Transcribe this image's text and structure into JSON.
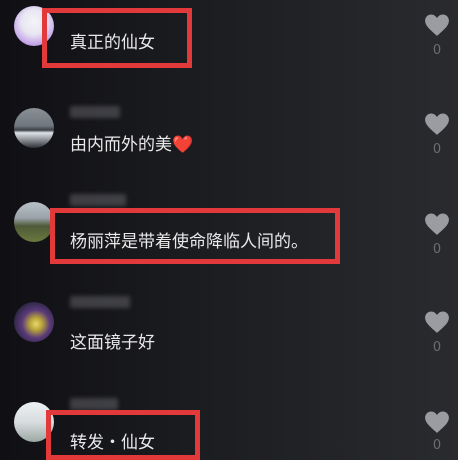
{
  "comments": [
    {
      "text": "真正的仙女",
      "likes": "0"
    },
    {
      "text": "由内而外的美",
      "emoji": "❤️",
      "likes": "0"
    },
    {
      "text": "杨丽萍是带着使命降临人间的。",
      "likes": "0"
    },
    {
      "text": "这面镜子好",
      "likes": "0"
    },
    {
      "text": "转发・仙女",
      "likes": "0"
    }
  ],
  "icons": {
    "like": "heart-icon"
  },
  "colors": {
    "highlight": "#e23a3a",
    "text": "#e9e9ea",
    "count": "#6c6d72"
  }
}
